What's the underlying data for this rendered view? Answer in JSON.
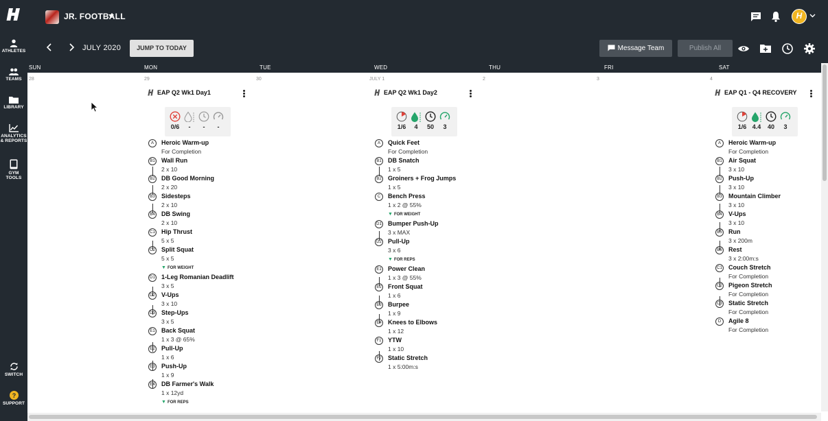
{
  "sidebar": {
    "items": [
      {
        "label1": "ATHLETES",
        "label2": ""
      },
      {
        "label1": "TEAMS",
        "label2": ""
      },
      {
        "label1": "LIBRARY",
        "label2": ""
      },
      {
        "label1": "ANALYTICS",
        "label2": "& REPORTS"
      },
      {
        "label1": "GYM",
        "label2": "TOOLS"
      },
      {
        "label1": "SWITCH",
        "label2": ""
      },
      {
        "label1": "SUPPORT",
        "label2": ""
      }
    ]
  },
  "header": {
    "team_name": "JR. FOOTBALL",
    "avatar_letter": "H",
    "month": "JULY 2020",
    "jump_label": "JUMP TO TODAY",
    "message_label": "Message Team",
    "publish_label": "Publish All"
  },
  "calendar": {
    "days": [
      "SUN",
      "MON",
      "TUE",
      "WED",
      "THU",
      "FRI",
      "SAT"
    ],
    "dates": [
      "28",
      "29",
      "30",
      "JULY 1",
      "2",
      "3",
      "4"
    ]
  },
  "workouts": [
    {
      "title": "EAP Q2 Wk1 Day1",
      "stats": [
        "0/6",
        "-",
        "-",
        "-"
      ],
      "exercises": [
        {
          "badge": "A",
          "name": "Heroic Warm-up",
          "sets": "For Completion",
          "tag": ""
        },
        {
          "badge": "B1",
          "name": "Wall Run",
          "sets": "2 x 10",
          "tag": ""
        },
        {
          "badge": "B2",
          "name": "DB Good Morning",
          "sets": "2 x 20",
          "tag": ""
        },
        {
          "badge": "B3",
          "name": "Sidesteps",
          "sets": "2 x 10",
          "tag": ""
        },
        {
          "badge": "B4",
          "name": "DB Swing",
          "sets": "2 x 10",
          "tag": ""
        },
        {
          "badge": "C1",
          "name": "Hip Thrust",
          "sets": "5 x 5",
          "tag": ""
        },
        {
          "badge": "C2",
          "name": "Split Squat",
          "sets": "5 x 5",
          "tag": "FOR WEIGHT"
        },
        {
          "badge": "D1",
          "name": "1-Leg Romanian Deadlift",
          "sets": "3 x 5",
          "tag": ""
        },
        {
          "badge": "D2",
          "name": "V-Ups",
          "sets": "3 x 10",
          "tag": ""
        },
        {
          "badge": "D3",
          "name": "Step-Ups",
          "sets": "3 x 5",
          "tag": ""
        },
        {
          "badge": "E1",
          "name": "Back Squat",
          "sets": "1 x 3 @ 65%",
          "tag": ""
        },
        {
          "badge": "E2",
          "name": "Pull-Up",
          "sets": "1 x 6",
          "tag": ""
        },
        {
          "badge": "E3",
          "name": "Push-Up",
          "sets": "1 x 9",
          "tag": ""
        },
        {
          "badge": "E4",
          "name": "DB Farmer's Walk",
          "sets": "1 x 12yd",
          "tag": "FOR REPS"
        }
      ]
    },
    {
      "title": "EAP Q2 Wk1 Day2",
      "stats": [
        "1/6",
        "4",
        "50",
        "3"
      ],
      "exercises": [
        {
          "badge": "A",
          "name": "Quick Feet",
          "sets": "For Completion",
          "tag": ""
        },
        {
          "badge": "B1",
          "name": "DB Snatch",
          "sets": "1 x 5",
          "tag": ""
        },
        {
          "badge": "B2",
          "name": "Groiners + Frog Jumps",
          "sets": "1 x 5",
          "tag": ""
        },
        {
          "badge": "C",
          "name": "Bench Press",
          "sets": "1 x 2 @ 55%",
          "tag": "FOR WEIGHT"
        },
        {
          "badge": "D1",
          "name": "Bumper Push-Up",
          "sets": "3 x MAX",
          "tag": ""
        },
        {
          "badge": "D2",
          "name": "Pull-Up",
          "sets": "3 x 6",
          "tag": "FOR REPS"
        },
        {
          "badge": "E1",
          "name": "Power Clean",
          "sets": "1 x 3 @ 55%",
          "tag": ""
        },
        {
          "badge": "E2",
          "name": "Front Squat",
          "sets": "1 x 6",
          "tag": ""
        },
        {
          "badge": "E3",
          "name": "Burpee",
          "sets": "1 x 9",
          "tag": ""
        },
        {
          "badge": "E4",
          "name": "Knees to Elbows",
          "sets": "1 x 12",
          "tag": ""
        },
        {
          "badge": "F1",
          "name": "YTW",
          "sets": "1 x 10",
          "tag": ""
        },
        {
          "badge": "F2",
          "name": "Static Stretch",
          "sets": "1 x 5:00m:s",
          "tag": ""
        }
      ]
    },
    {
      "title": "EAP Q1 - Q4 RECOVERY",
      "stats": [
        "1/6",
        "4.4",
        "40",
        "3"
      ],
      "exercises": [
        {
          "badge": "A",
          "name": "Heroic Warm-up",
          "sets": "For Completion",
          "tag": ""
        },
        {
          "badge": "B1",
          "name": "Air Squat",
          "sets": "3 x 10",
          "tag": ""
        },
        {
          "badge": "B2",
          "name": "Push-Up",
          "sets": "3 x 10",
          "tag": ""
        },
        {
          "badge": "B3",
          "name": "Mountain Climber",
          "sets": "3 x 10",
          "tag": ""
        },
        {
          "badge": "B4",
          "name": "V-Ups",
          "sets": "3 x 10",
          "tag": ""
        },
        {
          "badge": "B5",
          "name": "Run",
          "sets": "3 x 200m",
          "tag": ""
        },
        {
          "badge": "B6",
          "name": "Rest",
          "sets": "3 x 2:00m:s",
          "tag": ""
        },
        {
          "badge": "C1",
          "name": "Couch Stretch",
          "sets": "For Completion",
          "tag": ""
        },
        {
          "badge": "C2",
          "name": "Pigeon Stretch",
          "sets": "For Completion",
          "tag": ""
        },
        {
          "badge": "C3",
          "name": "Static Stretch",
          "sets": "For Completion",
          "tag": ""
        },
        {
          "badge": "D",
          "name": "Agile 8",
          "sets": "For Completion",
          "tag": ""
        }
      ]
    }
  ],
  "colors": {
    "nav": "#232a31",
    "accent_green": "#25a56a",
    "alert_red": "#e0433b",
    "avatar": "#f1b521"
  }
}
